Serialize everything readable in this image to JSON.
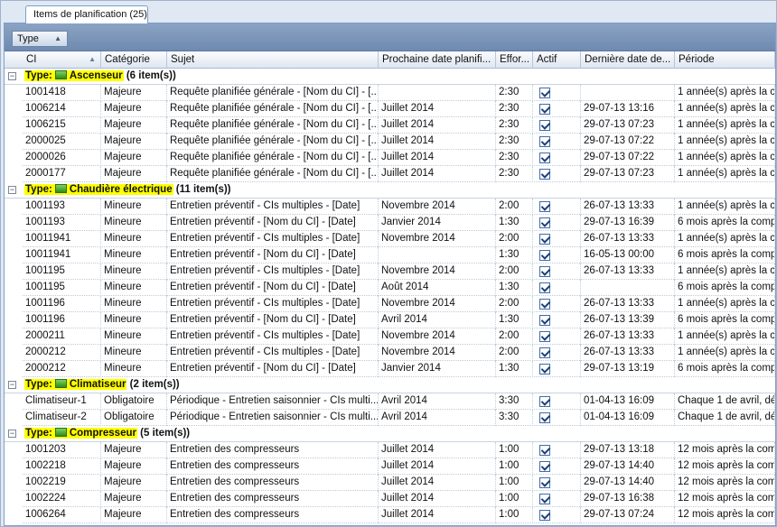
{
  "tab": {
    "label": "Items de planification (25)"
  },
  "group_chip": {
    "label": "Type"
  },
  "columns": [
    "CI",
    "Catégorie",
    "Sujet",
    "Prochaine date planifi...",
    "Effor...",
    "Actif",
    "Dernière date de...",
    "Période"
  ],
  "groups": [
    {
      "type": "Ascenseur",
      "count": "(6 item(s))",
      "rows": [
        [
          "1001418",
          "Majeure",
          "Requête planifiée générale - [Nom du CI] - [...",
          "",
          "2:30",
          true,
          "",
          "1 année(s) après la c"
        ],
        [
          "1006214",
          "Majeure",
          "Requête planifiée générale - [Nom du CI] - [...",
          "Juillet 2014",
          "2:30",
          true,
          "29-07-13 13:16",
          "1 année(s) après la c"
        ],
        [
          "1006215",
          "Majeure",
          "Requête planifiée générale - [Nom du CI] - [...",
          "Juillet 2014",
          "2:30",
          true,
          "29-07-13 07:23",
          "1 année(s) après la c"
        ],
        [
          "2000025",
          "Majeure",
          "Requête planifiée générale - [Nom du CI] - [...",
          "Juillet 2014",
          "2:30",
          true,
          "29-07-13 07:22",
          "1 année(s) après la c"
        ],
        [
          "2000026",
          "Majeure",
          "Requête planifiée générale - [Nom du CI] - [...",
          "Juillet 2014",
          "2:30",
          true,
          "29-07-13 07:22",
          "1 année(s) après la c"
        ],
        [
          "2000177",
          "Majeure",
          "Requête planifiée générale - [Nom du CI] - [...",
          "Juillet 2014",
          "2:30",
          true,
          "29-07-13 07:23",
          "1 année(s) après la c"
        ]
      ]
    },
    {
      "type": "Chaudière électrique",
      "count": "(11 item(s))",
      "rows": [
        [
          "1001193",
          "Mineure",
          "Entretien préventif - CIs multiples - [Date]",
          "Novembre 2014",
          "2:00",
          true,
          "26-07-13 13:33",
          "1 année(s) après la c"
        ],
        [
          "1001193",
          "Mineure",
          "Entretien préventif - [Nom du CI] - [Date]",
          "Janvier 2014",
          "1:30",
          true,
          "29-07-13 16:39",
          "6 mois après la comp"
        ],
        [
          "10011941",
          "Mineure",
          "Entretien préventif - CIs multiples - [Date]",
          "Novembre 2014",
          "2:00",
          true,
          "26-07-13 13:33",
          "1 année(s) après la c"
        ],
        [
          "10011941",
          "Mineure",
          "Entretien préventif - [Nom du CI] - [Date]",
          "",
          "1:30",
          true,
          "16-05-13 00:00",
          "6 mois après la comp"
        ],
        [
          "1001195",
          "Mineure",
          "Entretien préventif - CIs multiples - [Date]",
          "Novembre 2014",
          "2:00",
          true,
          "26-07-13 13:33",
          "1 année(s) après la c"
        ],
        [
          "1001195",
          "Mineure",
          "Entretien préventif - [Nom du CI] - [Date]",
          "Août 2014",
          "1:30",
          true,
          "",
          "6 mois après la comp"
        ],
        [
          "1001196",
          "Mineure",
          "Entretien préventif - CIs multiples - [Date]",
          "Novembre 2014",
          "2:00",
          true,
          "26-07-13 13:33",
          "1 année(s) après la c"
        ],
        [
          "1001196",
          "Mineure",
          "Entretien préventif - [Nom du CI] - [Date]",
          "Avril 2014",
          "1:30",
          true,
          "26-07-13 13:39",
          "6 mois après la comp"
        ],
        [
          "2000211",
          "Mineure",
          "Entretien préventif - CIs multiples - [Date]",
          "Novembre 2014",
          "2:00",
          true,
          "26-07-13 13:33",
          "1 année(s) après la c"
        ],
        [
          "2000212",
          "Mineure",
          "Entretien préventif - CIs multiples - [Date]",
          "Novembre 2014",
          "2:00",
          true,
          "26-07-13 13:33",
          "1 année(s) après la c"
        ],
        [
          "2000212",
          "Mineure",
          "Entretien préventif - [Nom du CI] - [Date]",
          "Janvier 2014",
          "1:30",
          true,
          "29-07-13 13:19",
          "6 mois après la comp"
        ]
      ]
    },
    {
      "type": "Climatiseur",
      "count": "(2 item(s))",
      "rows": [
        [
          "Climatiseur-1",
          "Obligatoire",
          "Périodique - Entretien saisonnier - CIs multi...",
          "Avril 2014",
          "3:30",
          true,
          "01-04-13 16:09",
          "Chaque 1 de avril, dé"
        ],
        [
          "Climatiseur-2",
          "Obligatoire",
          "Périodique - Entretien saisonnier - CIs multi...",
          "Avril 2014",
          "3:30",
          true,
          "01-04-13 16:09",
          "Chaque 1 de avril, dé"
        ]
      ]
    },
    {
      "type": "Compresseur",
      "count": "(5 item(s))",
      "rows": [
        [
          "1001203",
          "Majeure",
          "Entretien des compresseurs",
          "Juillet 2014",
          "1:00",
          true,
          "29-07-13 13:18",
          "12 mois après la com"
        ],
        [
          "1002218",
          "Majeure",
          "Entretien des compresseurs",
          "Juillet 2014",
          "1:00",
          true,
          "29-07-13 14:40",
          "12 mois après la com"
        ],
        [
          "1002219",
          "Majeure",
          "Entretien des compresseurs",
          "Juillet 2014",
          "1:00",
          true,
          "29-07-13 14:40",
          "12 mois après la com"
        ],
        [
          "1002224",
          "Majeure",
          "Entretien des compresseurs",
          "Juillet 2014",
          "1:00",
          true,
          "29-07-13 16:38",
          "12 mois après la com"
        ],
        [
          "1006264",
          "Majeure",
          "Entretien des compresseurs",
          "Juillet 2014",
          "1:00",
          true,
          "29-07-13 07:24",
          "12 mois après la com"
        ]
      ]
    }
  ],
  "icons": {
    "group": "green-folder-icon",
    "sort": "sort-ascending-icon"
  }
}
